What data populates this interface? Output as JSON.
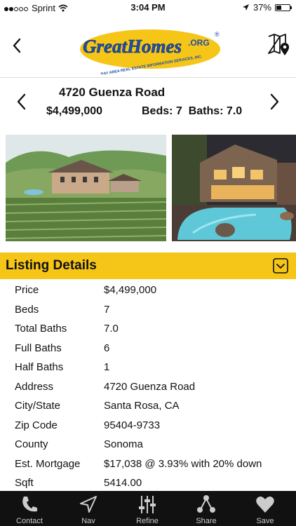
{
  "status": {
    "carrier": "Sprint",
    "time": "3:04 PM",
    "battery": "37%",
    "battery_level": 0.37
  },
  "header": {
    "logo_text": "GreatHomes",
    "logo_suffix": ".ORG",
    "logo_tagline": "BAY AREA REAL ESTATE INFORMATION SERVICES, INC."
  },
  "listing": {
    "address": "4720 Guenza Road",
    "price": "$4,499,000",
    "beds_baths": "Beds: 7  Baths: 7.0"
  },
  "section": {
    "title": "Listing Details"
  },
  "details": [
    {
      "label": "Price",
      "value": "$4,499,000"
    },
    {
      "label": "Beds",
      "value": "7"
    },
    {
      "label": "Total Baths",
      "value": "7.0"
    },
    {
      "label": "Full Baths",
      "value": "6"
    },
    {
      "label": "Half Baths",
      "value": "1"
    },
    {
      "label": "Address",
      "value": "4720 Guenza Road"
    },
    {
      "label": "City/State",
      "value": "Santa Rosa, CA"
    },
    {
      "label": "Zip Code",
      "value": "95404-9733"
    },
    {
      "label": "County",
      "value": "Sonoma"
    },
    {
      "label": "Est. Mortgage",
      "value": "$17,038 @ 3.93% with 20% down"
    },
    {
      "label": "Sqft",
      "value": "5414.00"
    }
  ],
  "tabs": [
    {
      "label": "Contact",
      "icon": "phone-icon"
    },
    {
      "label": "Nav",
      "icon": "navigation-arrow-icon"
    },
    {
      "label": "Refine",
      "icon": "sliders-icon"
    },
    {
      "label": "Share",
      "icon": "share-icon"
    },
    {
      "label": "Save",
      "icon": "heart-icon"
    }
  ],
  "colors": {
    "accent": "#f5c518",
    "tabbar": "#111111",
    "logo_blue": "#1f4fa8"
  }
}
